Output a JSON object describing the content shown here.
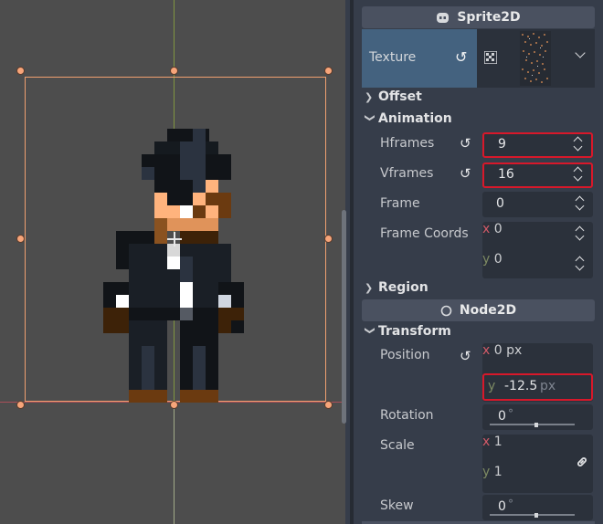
{
  "colors": {
    "accent": "#f0a070",
    "highlight": "#d8182a",
    "x_axis": "#e0485a",
    "y_axis": "#7fbf4a"
  },
  "inspector": {
    "sprite_header": {
      "title": "Sprite2D",
      "icon": "sprite2d-icon"
    },
    "texture": {
      "label": "Texture"
    },
    "categories": {
      "offset": "Offset",
      "animation": "Animation",
      "region": "Region",
      "transform": "Transform"
    },
    "hframes": {
      "label": "Hframes",
      "value": "9"
    },
    "vframes": {
      "label": "Vframes",
      "value": "16"
    },
    "frame": {
      "label": "Frame",
      "value": "0"
    },
    "frame_coords": {
      "label": "Frame Coords",
      "x_axis": "x",
      "x": "0",
      "y_axis": "y",
      "y": "0"
    },
    "node2d_header": {
      "title": "Node2D",
      "icon": "node2d-icon"
    },
    "position": {
      "label": "Position",
      "x_axis": "x",
      "x": "0",
      "y_axis": "y",
      "y": "-12.5",
      "unit": "px"
    },
    "rotation": {
      "label": "Rotation",
      "value": "0",
      "unit": "°"
    },
    "scale": {
      "label": "Scale",
      "x_axis": "x",
      "x": "1",
      "y_axis": "y",
      "y": "1"
    },
    "skew": {
      "label": "Skew",
      "value": "0",
      "unit": "°"
    }
  }
}
